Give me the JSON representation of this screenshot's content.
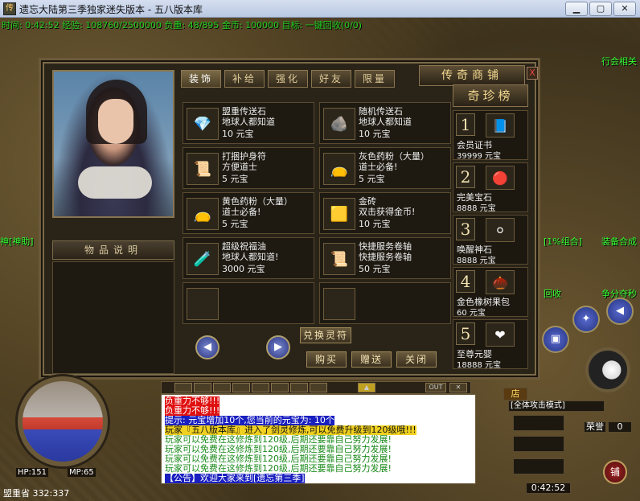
{
  "window": {
    "title": "遗忘大陆第三季独家迷失版本 - 五八版本库",
    "minimize": "▁",
    "maximize": "▢",
    "close": "✕"
  },
  "status_line": "时间: 0:42:52 经验: 108760/2500000 负重: 48/895 金币: 100000 目标: 一键回收(0/0)",
  "npcs": [
    "行会相关",
    "神[神助]",
    "回收",
    "装备合成",
    "争分夺秒",
    "[1%组合]"
  ],
  "shop": {
    "title": "传奇商铺",
    "close_label": "X",
    "tabs": [
      "装饰",
      "补给",
      "强化",
      "好友",
      "限量"
    ],
    "description_header": "物品说明",
    "items": [
      {
        "name": "盟重传送石",
        "desc": "地球人都知道",
        "price": "10 元宝",
        "icon": "teleport-stone-icon"
      },
      {
        "name": "随机传送石",
        "desc": "地球人都知道",
        "price": "10 元宝",
        "icon": "random-stone-icon"
      },
      {
        "name": "打捆护身符",
        "desc": "方便道士",
        "price": "5 元宝",
        "icon": "amulet-bundle-icon"
      },
      {
        "name": "灰色药粉（大量）",
        "desc": "道士必备!",
        "price": "5 元宝",
        "icon": "grey-powder-icon"
      },
      {
        "name": "黄色药粉（大量）",
        "desc": "道士必备!",
        "price": "5 元宝",
        "icon": "yellow-powder-icon"
      },
      {
        "name": "金砖",
        "desc": "双击获得金币!",
        "price": "10 元宝",
        "icon": "gold-brick-icon"
      },
      {
        "name": "超级祝福油",
        "desc": "地球人都知道!",
        "price": "3000 元宝",
        "icon": "bless-oil-icon"
      },
      {
        "name": "快捷服务卷轴",
        "desc": "快捷服务卷轴",
        "price": "50 元宝",
        "icon": "scroll-icon"
      }
    ],
    "exchange_label": "兑换灵符",
    "buy_label": "购买",
    "gift_label": "赠送",
    "close_btn_label": "关闭",
    "prev_label": "◀",
    "next_label": "▶",
    "treasure": {
      "title": "奇珍榜",
      "ranks": [
        {
          "num": "1",
          "name": "会员证书",
          "price": "39999 元宝",
          "icon": "certificate-icon"
        },
        {
          "num": "2",
          "name": "完美宝石",
          "price": "8888 元宝",
          "icon": "gem-icon"
        },
        {
          "num": "3",
          "name": "唤醒神石",
          "price": "8888 元宝",
          "icon": "moonstone-icon"
        },
        {
          "num": "4",
          "name": "金色橡树果包",
          "price": "60 元宝",
          "icon": "acorn-pack-icon"
        },
        {
          "num": "5",
          "name": "至尊元婴",
          "price": "18888 元宝",
          "icon": "yuanying-icon"
        }
      ]
    }
  },
  "hud": {
    "hp": "HP:151",
    "mp": "MP:65",
    "coords": "盟重省 332:337",
    "attack_mode": "[全体攻击模式]",
    "honor_label": "荣誉",
    "honor_value": "0",
    "time": "0:42:52",
    "shop_button": "铺",
    "shop_tab": "店"
  },
  "chat": {
    "lines": [
      {
        "text": "负重力不够!!!",
        "color": "#ffffff",
        "bg": "#e01010"
      },
      {
        "text": "负重力不够!!!",
        "color": "#ffffff",
        "bg": "#e01010"
      },
      {
        "text": "提示: 元宝增加10个,您当前的元宝为: 10个",
        "color": "#ffffff",
        "bg": "#1a20c0"
      },
      {
        "text": "玩家『五八版本库』进入了剑灵修炼,可以免费升级到120级哦!!!",
        "color": "#101010",
        "bg": "#f0d020"
      },
      {
        "text": "玩家可以免费在这修炼到120级,后期还要靠自己努力发展!",
        "color": "#1a8a1a",
        "bg": "#ffffff"
      },
      {
        "text": "玩家可以免费在这修炼到120级,后期还要靠自己努力发展!",
        "color": "#1a8a1a",
        "bg": "#ffffff"
      },
      {
        "text": "玩家可以免费在这修炼到120级,后期还要靠自己努力发展!",
        "color": "#1a8a1a",
        "bg": "#ffffff"
      },
      {
        "text": "玩家可以免费在这修炼到120级,后期还要靠自己努力发展!",
        "color": "#1a8a1a",
        "bg": "#ffffff"
      },
      {
        "text": "【公告】欢迎大家来到[遗忘第三季]",
        "color": "#ffffff",
        "bg": "#1a20c0"
      }
    ],
    "toolbar_out": "OUT"
  }
}
